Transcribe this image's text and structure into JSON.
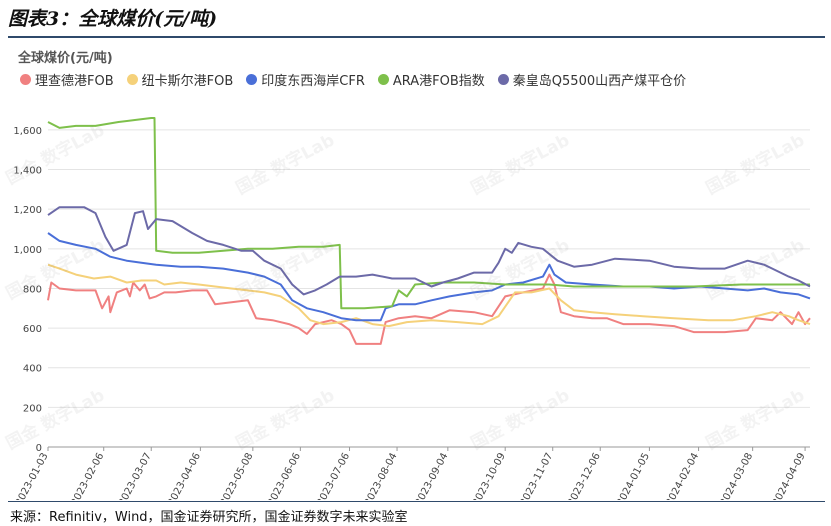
{
  "figure_title": "图表3：全球煤价(元/吨)",
  "source": "来源：Refinitiv，Wind，国金证券研究所，国金证券数字未来实验室",
  "watermark": "国金 数字Lab",
  "chart_data": {
    "type": "line",
    "title": "全球煤价(元/吨)",
    "ylim": [
      0,
      1650
    ],
    "yticks": [
      0,
      200,
      400,
      600,
      800,
      1000,
      1200,
      1400,
      1600
    ],
    "xlim": [
      "2023-01-03",
      "2024-04-12"
    ],
    "xticks": [
      "2023-01-03",
      "2023-02-06",
      "2023-03-07",
      "2023-04-06",
      "2023-05-08",
      "2023-06-06",
      "2023-07-06",
      "2023-08-04",
      "2023-09-04",
      "2023-10-09",
      "2023-11-07",
      "2023-12-06",
      "2024-01-05",
      "2024-02-04",
      "2024-03-08",
      "2024-04-09"
    ],
    "grid": "horizontal",
    "legend": "top-left",
    "series": [
      {
        "name": "理查德港FOB",
        "color": "#f08080",
        "points": [
          [
            "2023-01-03",
            740
          ],
          [
            "2023-01-05",
            830
          ],
          [
            "2023-01-10",
            800
          ],
          [
            "2023-01-20",
            790
          ],
          [
            "2023-02-01",
            790
          ],
          [
            "2023-02-05",
            700
          ],
          [
            "2023-02-09",
            760
          ],
          [
            "2023-02-10",
            680
          ],
          [
            "2023-02-14",
            780
          ],
          [
            "2023-02-20",
            800
          ],
          [
            "2023-02-22",
            760
          ],
          [
            "2023-02-24",
            830
          ],
          [
            "2023-02-28",
            790
          ],
          [
            "2023-03-03",
            820
          ],
          [
            "2023-03-06",
            750
          ],
          [
            "2023-03-10",
            760
          ],
          [
            "2023-03-15",
            780
          ],
          [
            "2023-03-22",
            780
          ],
          [
            "2023-04-01",
            790
          ],
          [
            "2023-04-10",
            790
          ],
          [
            "2023-04-15",
            720
          ],
          [
            "2023-04-25",
            730
          ],
          [
            "2023-05-05",
            740
          ],
          [
            "2023-05-10",
            650
          ],
          [
            "2023-05-20",
            640
          ],
          [
            "2023-05-30",
            620
          ],
          [
            "2023-06-05",
            600
          ],
          [
            "2023-06-10",
            570
          ],
          [
            "2023-06-15",
            620
          ],
          [
            "2023-06-25",
            640
          ],
          [
            "2023-07-01",
            620
          ],
          [
            "2023-07-06",
            590
          ],
          [
            "2023-07-10",
            520
          ],
          [
            "2023-07-25",
            520
          ],
          [
            "2023-07-28",
            630
          ],
          [
            "2023-08-05",
            650
          ],
          [
            "2023-08-15",
            660
          ],
          [
            "2023-08-25",
            650
          ],
          [
            "2023-09-05",
            690
          ],
          [
            "2023-09-20",
            680
          ],
          [
            "2023-10-01",
            660
          ],
          [
            "2023-10-09",
            760
          ],
          [
            "2023-10-20",
            780
          ],
          [
            "2023-11-01",
            800
          ],
          [
            "2023-11-05",
            870
          ],
          [
            "2023-11-08",
            820
          ],
          [
            "2023-11-12",
            680
          ],
          [
            "2023-11-20",
            660
          ],
          [
            "2023-12-01",
            650
          ],
          [
            "2023-12-10",
            650
          ],
          [
            "2023-12-20",
            620
          ],
          [
            "2024-01-05",
            620
          ],
          [
            "2024-01-20",
            610
          ],
          [
            "2024-02-01",
            580
          ],
          [
            "2024-02-20",
            580
          ],
          [
            "2024-03-05",
            590
          ],
          [
            "2024-03-10",
            650
          ],
          [
            "2024-03-20",
            640
          ],
          [
            "2024-03-25",
            680
          ],
          [
            "2024-04-01",
            620
          ],
          [
            "2024-04-05",
            680
          ],
          [
            "2024-04-09",
            620
          ],
          [
            "2024-04-12",
            650
          ]
        ]
      },
      {
        "name": "纽卡斯尔港FOB",
        "color": "#f5d17a",
        "points": [
          [
            "2023-01-03",
            920
          ],
          [
            "2023-01-10",
            900
          ],
          [
            "2023-01-20",
            870
          ],
          [
            "2023-01-31",
            850
          ],
          [
            "2023-02-10",
            860
          ],
          [
            "2023-02-20",
            830
          ],
          [
            "2023-03-01",
            840
          ],
          [
            "2023-03-10",
            840
          ],
          [
            "2023-03-15",
            820
          ],
          [
            "2023-03-25",
            830
          ],
          [
            "2023-04-05",
            820
          ],
          [
            "2023-04-15",
            810
          ],
          [
            "2023-04-25",
            800
          ],
          [
            "2023-05-05",
            790
          ],
          [
            "2023-05-15",
            780
          ],
          [
            "2023-05-25",
            760
          ],
          [
            "2023-06-05",
            700
          ],
          [
            "2023-06-12",
            640
          ],
          [
            "2023-06-20",
            620
          ],
          [
            "2023-07-01",
            630
          ],
          [
            "2023-07-10",
            650
          ],
          [
            "2023-07-20",
            620
          ],
          [
            "2023-07-30",
            610
          ],
          [
            "2023-08-10",
            630
          ],
          [
            "2023-08-25",
            640
          ],
          [
            "2023-09-10",
            630
          ],
          [
            "2023-09-25",
            620
          ],
          [
            "2023-10-05",
            660
          ],
          [
            "2023-10-15",
            780
          ],
          [
            "2023-10-25",
            780
          ],
          [
            "2023-11-05",
            800
          ],
          [
            "2023-11-12",
            740
          ],
          [
            "2023-11-20",
            690
          ],
          [
            "2023-12-01",
            680
          ],
          [
            "2023-12-15",
            670
          ],
          [
            "2024-01-01",
            660
          ],
          [
            "2024-01-20",
            650
          ],
          [
            "2024-02-10",
            640
          ],
          [
            "2024-02-25",
            640
          ],
          [
            "2024-03-10",
            660
          ],
          [
            "2024-03-20",
            680
          ],
          [
            "2024-03-30",
            660
          ],
          [
            "2024-04-05",
            640
          ],
          [
            "2024-04-12",
            620
          ]
        ]
      },
      {
        "name": "印度东西海岸CFR",
        "color": "#4a6fd8",
        "points": [
          [
            "2023-01-03",
            1080
          ],
          [
            "2023-01-10",
            1040
          ],
          [
            "2023-01-20",
            1020
          ],
          [
            "2023-02-01",
            1000
          ],
          [
            "2023-02-10",
            960
          ],
          [
            "2023-02-20",
            940
          ],
          [
            "2023-03-01",
            930
          ],
          [
            "2023-03-10",
            920
          ],
          [
            "2023-03-25",
            910
          ],
          [
            "2023-04-05",
            910
          ],
          [
            "2023-04-20",
            900
          ],
          [
            "2023-05-05",
            880
          ],
          [
            "2023-05-15",
            860
          ],
          [
            "2023-05-25",
            820
          ],
          [
            "2023-06-01",
            740
          ],
          [
            "2023-06-10",
            700
          ],
          [
            "2023-06-20",
            680
          ],
          [
            "2023-07-01",
            650
          ],
          [
            "2023-07-10",
            640
          ],
          [
            "2023-07-25",
            640
          ],
          [
            "2023-07-28",
            700
          ],
          [
            "2023-08-05",
            720
          ],
          [
            "2023-08-15",
            720
          ],
          [
            "2023-08-25",
            740
          ],
          [
            "2023-09-05",
            760
          ],
          [
            "2023-09-20",
            780
          ],
          [
            "2023-10-01",
            790
          ],
          [
            "2023-10-09",
            820
          ],
          [
            "2023-10-20",
            830
          ],
          [
            "2023-11-01",
            860
          ],
          [
            "2023-11-05",
            920
          ],
          [
            "2023-11-08",
            870
          ],
          [
            "2023-11-15",
            830
          ],
          [
            "2023-12-01",
            820
          ],
          [
            "2023-12-20",
            810
          ],
          [
            "2024-01-05",
            810
          ],
          [
            "2024-01-20",
            800
          ],
          [
            "2024-02-05",
            810
          ],
          [
            "2024-02-20",
            800
          ],
          [
            "2024-03-05",
            790
          ],
          [
            "2024-03-15",
            800
          ],
          [
            "2024-03-25",
            780
          ],
          [
            "2024-04-05",
            770
          ],
          [
            "2024-04-12",
            750
          ]
        ]
      },
      {
        "name": "ARA港FOB指数",
        "color": "#7ec04b",
        "points": [
          [
            "2023-01-03",
            1640
          ],
          [
            "2023-01-10",
            1610
          ],
          [
            "2023-01-20",
            1620
          ],
          [
            "2023-02-01",
            1620
          ],
          [
            "2023-02-15",
            1640
          ],
          [
            "2023-02-25",
            1650
          ],
          [
            "2023-03-07",
            1660
          ],
          [
            "2023-03-09",
            1660
          ],
          [
            "2023-03-10",
            990
          ],
          [
            "2023-03-20",
            980
          ],
          [
            "2023-04-05",
            980
          ],
          [
            "2023-04-20",
            990
          ],
          [
            "2023-05-05",
            1000
          ],
          [
            "2023-05-20",
            1000
          ],
          [
            "2023-06-05",
            1010
          ],
          [
            "2023-06-20",
            1010
          ],
          [
            "2023-06-30",
            1020
          ],
          [
            "2023-07-01",
            700
          ],
          [
            "2023-07-15",
            700
          ],
          [
            "2023-08-01",
            710
          ],
          [
            "2023-08-05",
            790
          ],
          [
            "2023-08-10",
            760
          ],
          [
            "2023-08-15",
            820
          ],
          [
            "2023-09-01",
            830
          ],
          [
            "2023-09-20",
            830
          ],
          [
            "2023-10-09",
            820
          ],
          [
            "2023-10-20",
            820
          ],
          [
            "2023-11-05",
            820
          ],
          [
            "2023-11-20",
            810
          ],
          [
            "2023-12-10",
            810
          ],
          [
            "2024-01-05",
            810
          ],
          [
            "2024-02-01",
            810
          ],
          [
            "2024-03-01",
            820
          ],
          [
            "2024-04-12",
            820
          ]
        ]
      },
      {
        "name": "秦皇岛Q5500山西产煤平仓价",
        "color": "#6c6aa8",
        "points": [
          [
            "2023-01-03",
            1170
          ],
          [
            "2023-01-10",
            1210
          ],
          [
            "2023-01-25",
            1210
          ],
          [
            "2023-02-01",
            1180
          ],
          [
            "2023-02-07",
            1060
          ],
          [
            "2023-02-12",
            990
          ],
          [
            "2023-02-20",
            1020
          ],
          [
            "2023-02-25",
            1180
          ],
          [
            "2023-03-02",
            1190
          ],
          [
            "2023-03-05",
            1100
          ],
          [
            "2023-03-10",
            1150
          ],
          [
            "2023-03-20",
            1140
          ],
          [
            "2023-04-01",
            1080
          ],
          [
            "2023-04-10",
            1040
          ],
          [
            "2023-04-20",
            1020
          ],
          [
            "2023-05-01",
            990
          ],
          [
            "2023-05-08",
            990
          ],
          [
            "2023-05-15",
            940
          ],
          [
            "2023-05-25",
            900
          ],
          [
            "2023-06-01",
            820
          ],
          [
            "2023-06-08",
            770
          ],
          [
            "2023-06-15",
            790
          ],
          [
            "2023-06-22",
            820
          ],
          [
            "2023-06-30",
            860
          ],
          [
            "2023-07-10",
            860
          ],
          [
            "2023-07-20",
            870
          ],
          [
            "2023-08-01",
            850
          ],
          [
            "2023-08-15",
            850
          ],
          [
            "2023-08-25",
            810
          ],
          [
            "2023-09-01",
            830
          ],
          [
            "2023-09-10",
            850
          ],
          [
            "2023-09-20",
            880
          ],
          [
            "2023-10-01",
            880
          ],
          [
            "2023-10-05",
            930
          ],
          [
            "2023-10-09",
            1000
          ],
          [
            "2023-10-13",
            980
          ],
          [
            "2023-10-17",
            1030
          ],
          [
            "2023-10-25",
            1010
          ],
          [
            "2023-11-01",
            1000
          ],
          [
            "2023-11-10",
            940
          ],
          [
            "2023-11-20",
            910
          ],
          [
            "2023-12-01",
            920
          ],
          [
            "2023-12-15",
            950
          ],
          [
            "2024-01-05",
            940
          ],
          [
            "2024-01-20",
            910
          ],
          [
            "2024-02-05",
            900
          ],
          [
            "2024-02-20",
            900
          ],
          [
            "2024-03-05",
            940
          ],
          [
            "2024-03-15",
            920
          ],
          [
            "2024-03-20",
            900
          ],
          [
            "2024-03-30",
            860
          ],
          [
            "2024-04-05",
            840
          ],
          [
            "2024-04-12",
            810
          ]
        ]
      }
    ]
  }
}
